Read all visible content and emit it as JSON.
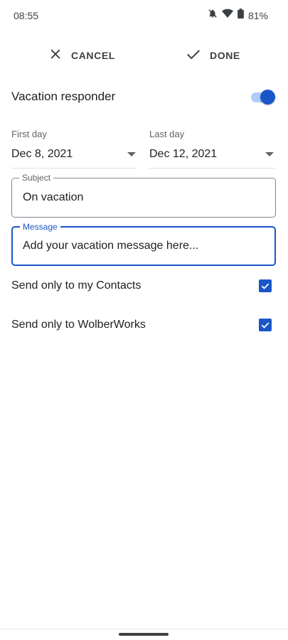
{
  "status_bar": {
    "time": "08:55",
    "battery_percent": "81%",
    "icons": [
      "notifications-off-icon",
      "wifi-icon",
      "battery-icon"
    ]
  },
  "action_bar": {
    "cancel_label": "CANCEL",
    "done_label": "DONE"
  },
  "vacation_responder": {
    "label": "Vacation responder",
    "enabled": true
  },
  "dates": {
    "first_day_label": "First day",
    "first_day_value": "Dec 8, 2021",
    "last_day_label": "Last day",
    "last_day_value": "Dec 12, 2021"
  },
  "subject": {
    "label": "Subject",
    "value": "On vacation"
  },
  "message": {
    "label": "Message",
    "placeholder": "Add your vacation message here..."
  },
  "options": {
    "contacts_label": "Send only to my Contacts",
    "contacts_checked": true,
    "domain_label": "Send only to WolberWorks",
    "domain_checked": true
  },
  "colors": {
    "accent": "#1a56c8",
    "track": "#aecbfa",
    "text": "#202124",
    "secondary_text": "#5f6368"
  }
}
